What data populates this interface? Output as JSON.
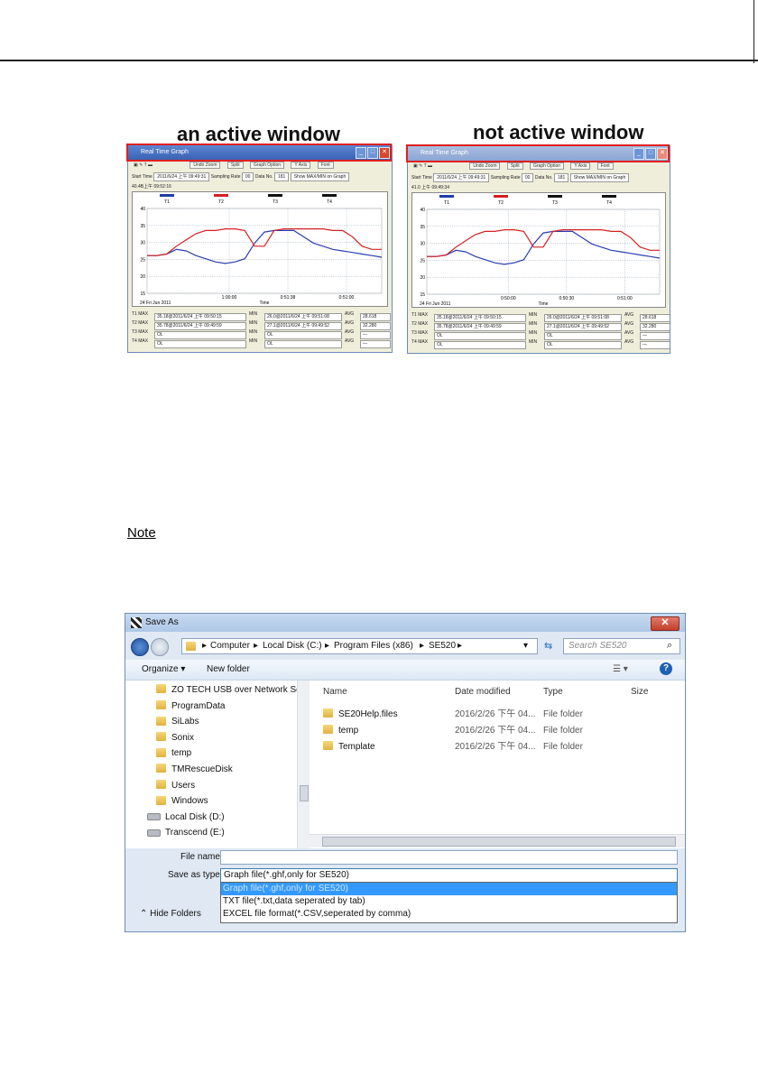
{
  "captions": {
    "active": "an active window",
    "inactive": "not active window"
  },
  "graph_window": {
    "title_active": "Real Time Graph",
    "title_inactive": "Real Time Graph",
    "toolbar": [
      "Undo Zoom",
      "Split",
      "Graph Option",
      "Y Axis",
      "Font"
    ],
    "start_time_label": "Start Time",
    "start_time": "2011/6/24 上午 09:49:31",
    "sampling_label": "Sampling Rate",
    "sampling_value": "00",
    "data_no_label": "Data No.",
    "data_no": "181",
    "show_btn": "Show MAX/MIN on Graph",
    "cursor_time_active": "40.4B上午 09:52:16",
    "cursor_time_inactive": "41.0 上午 09:49:34",
    "legend": [
      "T1",
      "T2",
      "T3",
      "T4"
    ],
    "legend_colors": [
      "#1e3da8",
      "#d42020",
      "#111111",
      "#111111"
    ],
    "y_ticks": [
      "40",
      "35",
      "30",
      "25",
      "20",
      "15"
    ],
    "x_date": "24 Fri Jun 2011",
    "x_ticks_active": [
      "1:00:00",
      "0:51:38",
      "0:51:00"
    ],
    "x_ticks_inactive": [
      "0:50:00",
      "0:50:30",
      "0:51:00"
    ],
    "x_label": "Time",
    "stats": [
      {
        "label": "T1 MAX",
        "max": "35.18@2011/6/24 上午 09:50:15",
        "min_label": "MIN",
        "min": "26.0@2011/6/24 上午 09:51:08",
        "avg_label": "AVG",
        "avg": "28.618"
      },
      {
        "label": "T2 MAX",
        "max": "35.78@2011/6/24 上午 09:49:59",
        "min_label": "MIN",
        "min": "27.1@2011/6/24 上午 09:49:52",
        "avg_label": "AVG",
        "avg": "32.280"
      },
      {
        "label": "T3 MAX",
        "max": "OL",
        "min_label": "MIN",
        "min": "OL",
        "avg_label": "AVG",
        "avg": "—"
      },
      {
        "label": "T4 MAX",
        "max": "OL",
        "min_label": "MIN",
        "min": "OL",
        "avg_label": "AVG",
        "avg": "—"
      }
    ]
  },
  "note": "Note",
  "dialog": {
    "title": "Save As",
    "close": "✕",
    "breadcrumbs": [
      "Computer",
      "Local Disk (C:)",
      "Program Files (x86)",
      "SE520"
    ],
    "search_placeholder": "Search SE520",
    "toolbar": {
      "organize": "Organize ▾",
      "new_folder": "New folder"
    },
    "nav_items": [
      {
        "label": "ZO TECH USB over Network Se",
        "type": "folder"
      },
      {
        "label": "ProgramData",
        "type": "folder"
      },
      {
        "label": "SiLabs",
        "type": "folder"
      },
      {
        "label": "Sonix",
        "type": "folder"
      },
      {
        "label": "temp",
        "type": "folder"
      },
      {
        "label": "TMRescueDisk",
        "type": "folder"
      },
      {
        "label": "Users",
        "type": "folder"
      },
      {
        "label": "Windows",
        "type": "folder"
      },
      {
        "label": "Local Disk (D:)",
        "type": "drive"
      },
      {
        "label": "Transcend (E:)",
        "type": "drive"
      }
    ],
    "columns": [
      "Name",
      "Date modified",
      "Type",
      "Size"
    ],
    "files": [
      {
        "name": "SE20Help.files",
        "date": "2016/2/26 下午 04...",
        "type": "File folder"
      },
      {
        "name": "temp",
        "date": "2016/2/26 下午 04...",
        "type": "File folder"
      },
      {
        "name": "Template",
        "date": "2016/2/26 下午 04...",
        "type": "File folder"
      }
    ],
    "file_name_label": "File name:",
    "file_name_value": "",
    "save_type_label": "Save as type:",
    "save_type_value": "Graph file(*.ghf,only for SE520)",
    "save_type_options": [
      "Graph file(*.ghf,only for SE520)",
      "TXT file(*.txt,data seperated by tab)",
      "EXCEL file format(*.CSV,seperated by comma)"
    ],
    "hide_folders": "Hide Folders"
  }
}
